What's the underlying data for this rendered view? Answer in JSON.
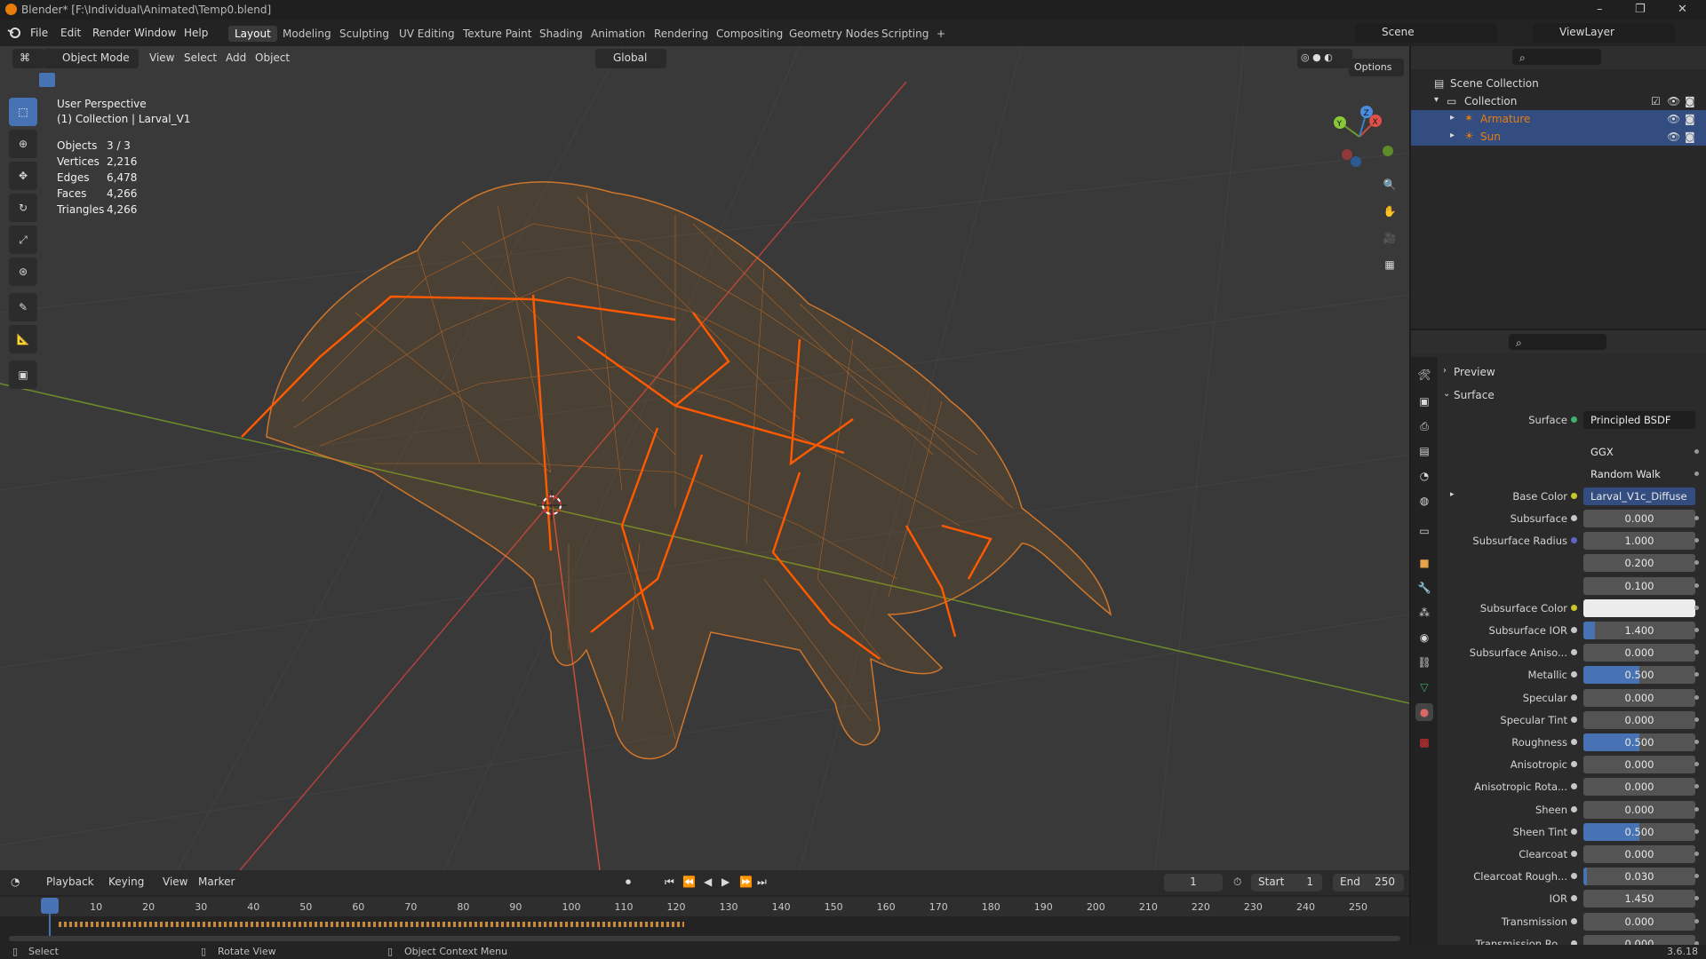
{
  "window": {
    "title": "Blender* [F:\\Individual\\Animated\\Temp0.blend]",
    "minimize": "–",
    "maximize": "❐",
    "close": "✕"
  },
  "menu": {
    "items": [
      "File",
      "Edit",
      "Render",
      "Window",
      "Help"
    ]
  },
  "workspaces": [
    "Layout",
    "Modeling",
    "Sculpting",
    "UV Editing",
    "Texture Paint",
    "Shading",
    "Animation",
    "Rendering",
    "Compositing",
    "Geometry Nodes",
    "Scripting",
    "+"
  ],
  "active_workspace": "Layout",
  "scene": {
    "name": "Scene",
    "view_layer": "ViewLayer"
  },
  "viewport": {
    "mode": "Object Mode",
    "menus": [
      "View",
      "Select",
      "Add",
      "Object"
    ],
    "orientation": "Global",
    "options": "Options",
    "perspective": "User Perspective",
    "collection_info": "(1) Collection | Larval_V1",
    "stats": [
      {
        "label": "Objects",
        "value": "3 / 3"
      },
      {
        "label": "Vertices",
        "value": "2,216"
      },
      {
        "label": "Edges",
        "value": "6,478"
      },
      {
        "label": "Faces",
        "value": "4,266"
      },
      {
        "label": "Triangles",
        "value": "4,266"
      }
    ],
    "gizmo": {
      "x": "X",
      "y": "Y",
      "z": "Z"
    },
    "tools": [
      "select-box-icon",
      "cursor-icon",
      "move-icon",
      "rotate-icon",
      "scale-icon",
      "transform-icon",
      "annotate-icon",
      "measure-icon",
      "add-cube-icon"
    ]
  },
  "outliner": {
    "root": "Scene Collection",
    "collection": "Collection",
    "items": [
      {
        "name": "Armature",
        "color": "#e87d0d"
      },
      {
        "name": "Sun",
        "color": "#e87d0d"
      }
    ]
  },
  "properties": {
    "preview": "Preview",
    "surface_panel": "Surface",
    "surface_label": "Surface",
    "surface_value": "Principled BSDF",
    "distribution": "GGX",
    "subsurface_method": "Random Walk",
    "base_color_label": "Base Color",
    "base_color_value": "Larval_V1c_Diffuse",
    "rows": [
      {
        "label": "Subsurface",
        "value": "0.000",
        "fill": 0
      },
      {
        "label": "Subsurface Radius",
        "value": "1.000",
        "fill": 0
      },
      {
        "label": "",
        "value": "0.200",
        "fill": 0
      },
      {
        "label": "",
        "value": "0.100",
        "fill": 0
      },
      {
        "label": "Subsurface Color",
        "value": "",
        "fill": 0,
        "white": true
      },
      {
        "label": "Subsurface IOR",
        "value": "1.400",
        "fill": 0.1
      },
      {
        "label": "Subsurface Aniso...",
        "value": "0.000",
        "fill": 0
      },
      {
        "label": "Metallic",
        "value": "0.500",
        "fill": 0.5
      },
      {
        "label": "Specular",
        "value": "0.000",
        "fill": 0
      },
      {
        "label": "Specular Tint",
        "value": "0.000",
        "fill": 0
      },
      {
        "label": "Roughness",
        "value": "0.500",
        "fill": 0.5
      },
      {
        "label": "Anisotropic",
        "value": "0.000",
        "fill": 0
      },
      {
        "label": "Anisotropic Rota...",
        "value": "0.000",
        "fill": 0
      },
      {
        "label": "Sheen",
        "value": "0.000",
        "fill": 0
      },
      {
        "label": "Sheen Tint",
        "value": "0.500",
        "fill": 0.5
      },
      {
        "label": "Clearcoat",
        "value": "0.000",
        "fill": 0
      },
      {
        "label": "Clearcoat Rough...",
        "value": "0.030",
        "fill": 0.03
      },
      {
        "label": "IOR",
        "value": "1.450",
        "fill": 0
      },
      {
        "label": "Transmission",
        "value": "0.000",
        "fill": 0
      },
      {
        "label": "Transmission Ro...",
        "value": "0.000",
        "fill": 0
      }
    ]
  },
  "timeline": {
    "menus": [
      "Playback",
      "Keying",
      "View",
      "Marker"
    ],
    "current_frame": "1",
    "start_label": "Start",
    "start": "1",
    "end_label": "End",
    "end": "250",
    "ticks": [
      "1",
      "10",
      "20",
      "30",
      "40",
      "50",
      "60",
      "70",
      "80",
      "90",
      "100",
      "110",
      "120",
      "130",
      "140",
      "150",
      "160",
      "170",
      "180",
      "190",
      "200",
      "210",
      "220",
      "230",
      "240",
      "250"
    ]
  },
  "status": {
    "select": "Select",
    "rotate": "Rotate View",
    "context": "Object Context Menu",
    "version": "3.6.18"
  },
  "colors": {
    "accent": "#4772b3",
    "wire": "#e87d0d",
    "bone": "#ff5a00"
  }
}
